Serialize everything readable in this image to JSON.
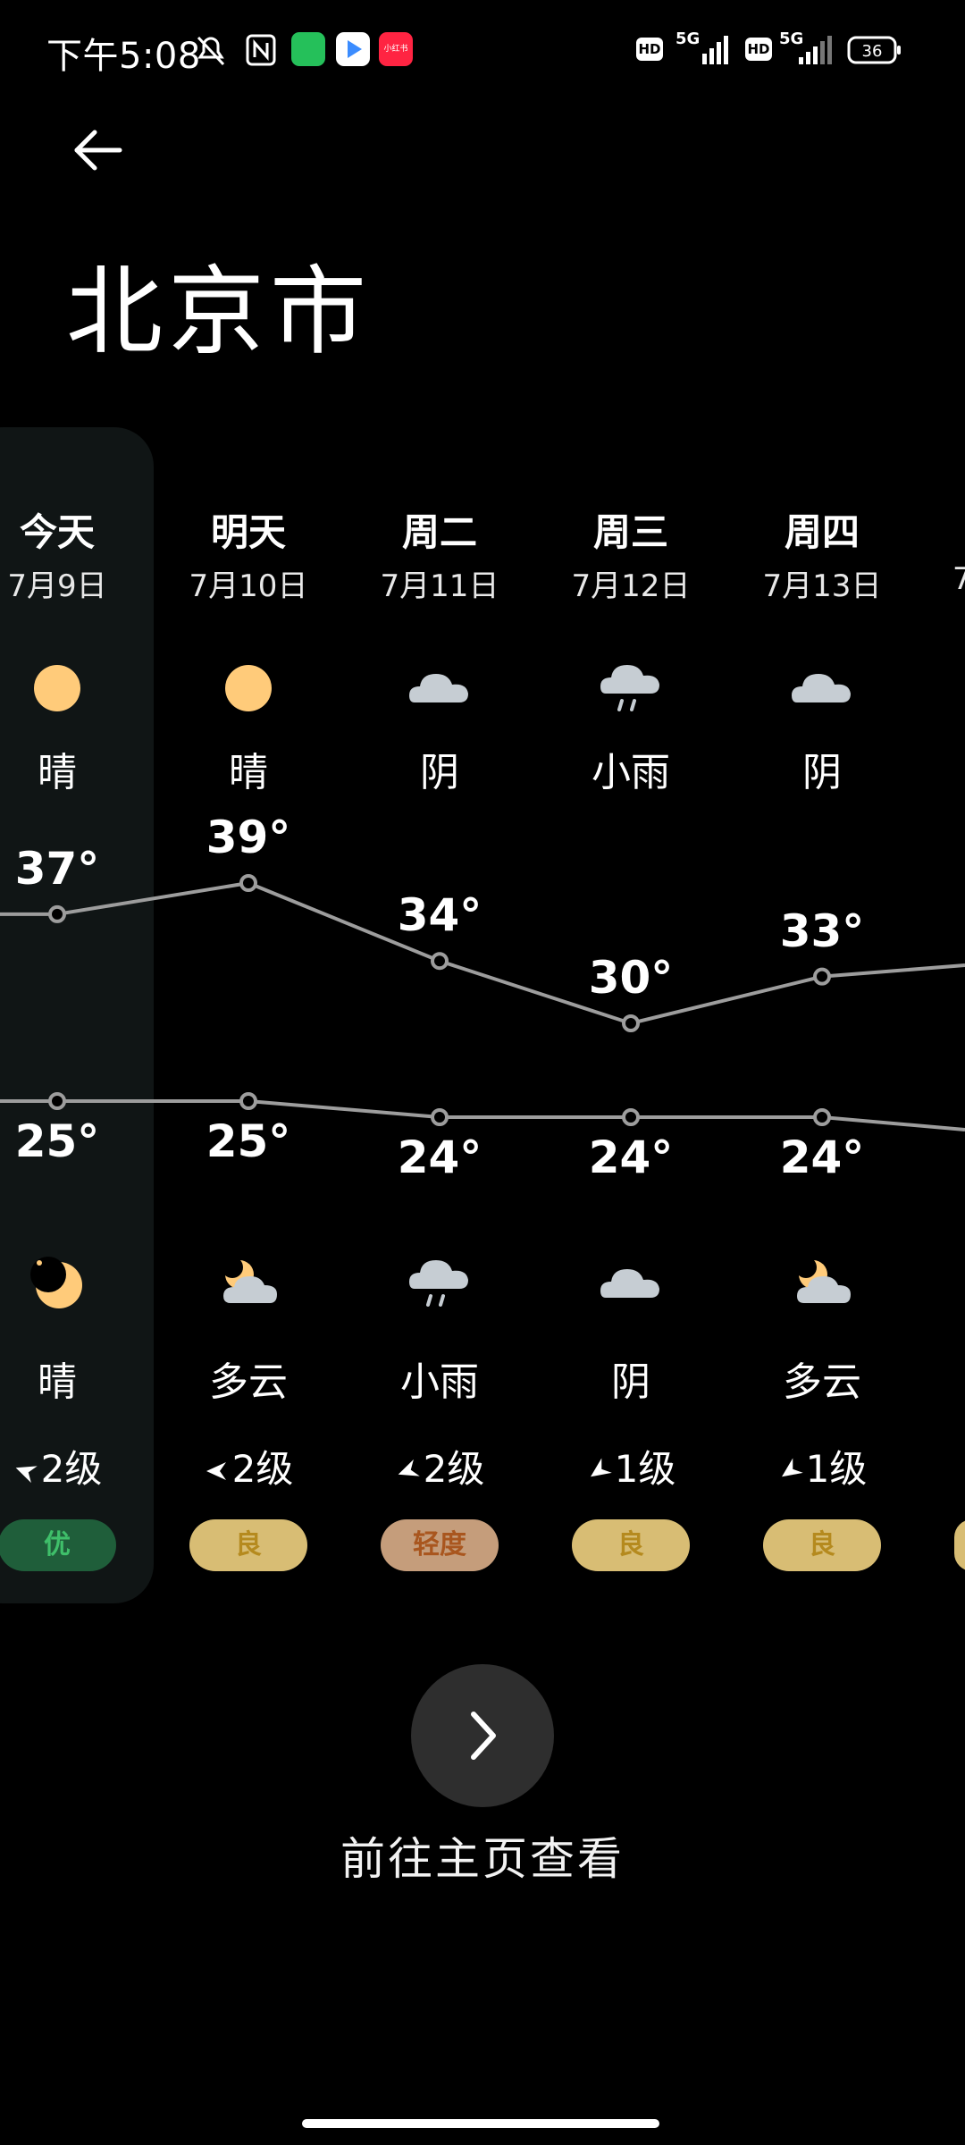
{
  "status_bar": {
    "time": "下午5:08",
    "net_1": "5G",
    "net_2": "5G",
    "hd": "HD",
    "battery": "36",
    "app_badge_text": "小红书"
  },
  "header": {
    "city": "北京市"
  },
  "days": [
    {
      "day": "今天",
      "date": "7月9日",
      "day_icon": "sun-icon",
      "day_cond": "晴",
      "high": "37°",
      "low": "25°",
      "night_icon": "moon-icon",
      "night_cond": "晴",
      "wind": "2级",
      "aqi": "优",
      "aqi_color": "#1f5e3a",
      "aqi_text_color": "#3fbf6a"
    },
    {
      "day": "明天",
      "date": "7月10日",
      "day_icon": "sun-icon",
      "day_cond": "晴",
      "high": "39°",
      "low": "25°",
      "night_icon": "partly-cloudy-night-icon",
      "night_cond": "多云",
      "wind": "2级",
      "aqi": "良",
      "aqi_color": "#d8bd74",
      "aqi_text_color": "#b58a1e"
    },
    {
      "day": "周二",
      "date": "7月11日",
      "day_icon": "cloud-icon",
      "day_cond": "阴",
      "high": "34°",
      "low": "24°",
      "night_icon": "rain-icon",
      "night_cond": "小雨",
      "wind": "2级",
      "aqi": "轻度",
      "aqi_color": "#c59d7b",
      "aqi_text_color": "#a9561e"
    },
    {
      "day": "周三",
      "date": "7月12日",
      "day_icon": "rain-icon",
      "day_cond": "小雨",
      "high": "30°",
      "low": "24°",
      "night_icon": "cloud-icon",
      "night_cond": "阴",
      "wind": "1级",
      "aqi": "良",
      "aqi_color": "#d8bd74",
      "aqi_text_color": "#b58a1e"
    },
    {
      "day": "周四",
      "date": "7月13日",
      "day_icon": "cloud-icon",
      "day_cond": "阴",
      "high": "33°",
      "low": "24°",
      "night_icon": "partly-cloudy-night-icon",
      "night_cond": "多云",
      "wind": "1级",
      "aqi": "良",
      "aqi_color": "#d8bd74",
      "aqi_text_color": "#b58a1e"
    }
  ],
  "partial_next": {
    "date_fragment": "7"
  },
  "chart_data": {
    "type": "line",
    "categories": [
      "今天",
      "明天",
      "周二",
      "周三",
      "周四"
    ],
    "series": [
      {
        "values": [
          37,
          39,
          34,
          30,
          33
        ]
      },
      {
        "values": [
          25,
          25,
          24,
          24,
          24
        ]
      }
    ]
  },
  "footer": {
    "go_label": "前往主页查看"
  },
  "colors": {
    "sun": "#ffcb7a",
    "cloud": "#c6cdd3",
    "line": "#9d9d9d",
    "bg": "#000000",
    "today_bg": "#101515"
  }
}
